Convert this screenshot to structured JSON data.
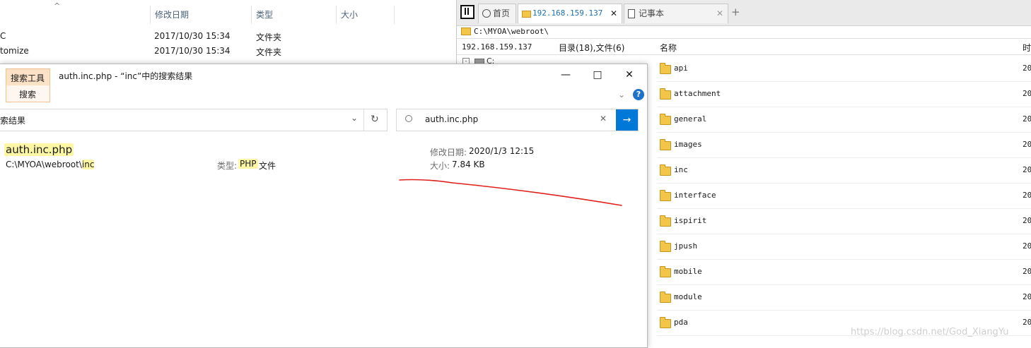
{
  "bg_explorer": {
    "sort_arrow": "^",
    "columns": [
      "修改日期",
      "类型",
      "大小"
    ],
    "rows": [
      {
        "name": "C",
        "date": "2017/10/30 15:34",
        "type": "文件夹",
        "size": ""
      },
      {
        "name": "tomize",
        "date": "2017/10/30 15:34",
        "type": "文件夹",
        "size": ""
      }
    ]
  },
  "remote": {
    "tabs": [
      {
        "label": "首页",
        "icon": "globe-icon"
      },
      {
        "label": "192.168.159.137",
        "icon": "folder-icon"
      },
      {
        "label": "记事本",
        "icon": "notepad-icon"
      }
    ],
    "tab_close": "✕",
    "tab_add": "+",
    "path": "C:\\MYOA\\webroot\\",
    "info": {
      "ip": "192.168.159.137",
      "summary": "目录(18),文件(6)",
      "col_name": "名称",
      "col_time": "时"
    },
    "tree_root": "C:",
    "folders": [
      {
        "name": "api",
        "date": "20"
      },
      {
        "name": "attachment",
        "date": "20"
      },
      {
        "name": "general",
        "date": "20"
      },
      {
        "name": "images",
        "date": "20"
      },
      {
        "name": "inc",
        "date": "20"
      },
      {
        "name": "interface",
        "date": "20"
      },
      {
        "name": "ispirit",
        "date": "20"
      },
      {
        "name": "jpush",
        "date": "20"
      },
      {
        "name": "mobile",
        "date": "20"
      },
      {
        "name": "module",
        "date": "20"
      },
      {
        "name": "pda",
        "date": "20"
      }
    ]
  },
  "search_window": {
    "ribbon_tab_top": "搜索工具",
    "ribbon_tab_bottom": "搜索",
    "title": "auth.inc.php - “inc”中的搜索结果",
    "minimize": "—",
    "maximize": "□",
    "close": "✕",
    "help": "?",
    "address_text": "索结果",
    "refresh": "↻",
    "search_query": "auth.inc.php",
    "search_clear": "✕",
    "search_go": "→",
    "result": {
      "filename": "auth.inc.php",
      "path_prefix": "C:\\MYOA\\webroot\\",
      "path_highlight": "inc",
      "type_label": "类型:",
      "type_value": "PHP",
      "type_suffix": "文件",
      "modified_label": "修改日期:",
      "modified_value": "2020/1/3 12:15",
      "size_label": "大小:",
      "size_value": "7.84 KB"
    }
  },
  "watermark": "https://blog.csdn.net/God_XiangYu",
  "colors": {
    "annotation": "#e0201b",
    "accent": "#0078d7",
    "highlight": "#fdf7a5"
  }
}
